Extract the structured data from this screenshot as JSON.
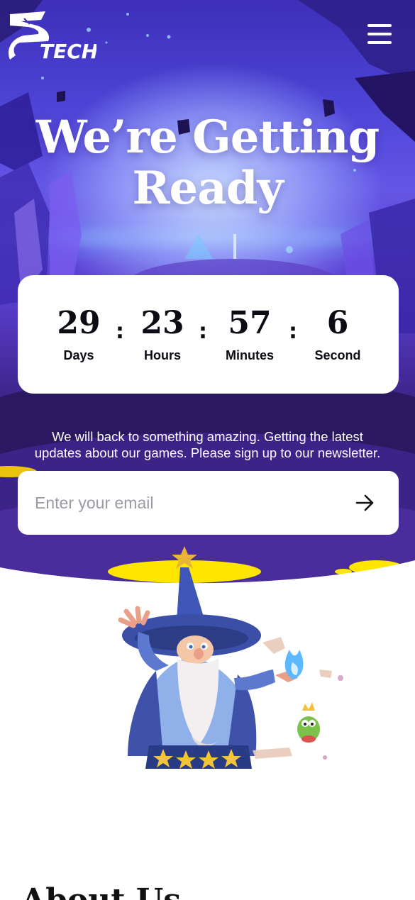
{
  "brand": {
    "logo_text": "TECH",
    "icon": "ztech-logo"
  },
  "nav": {
    "menu_icon": "hamburger-menu-icon"
  },
  "hero": {
    "headline_line1": "We’re Getting",
    "headline_line2": "Ready"
  },
  "countdown": {
    "days": {
      "value": "29",
      "label": "Days"
    },
    "hours": {
      "value": "23",
      "label": "Hours"
    },
    "minutes": {
      "value": "57",
      "label": "Minutes"
    },
    "seconds": {
      "value": "6",
      "label": "Second"
    },
    "separator": ":"
  },
  "newsletter": {
    "message_line1": "We will back to something amazing. Getting the latest",
    "message_line2": "updates about our games. Please sign up to our newsletter.",
    "email_placeholder": "Enter your email",
    "submit_icon": "arrow-right-icon"
  },
  "about": {
    "heading": "About Us"
  },
  "colors": {
    "hero_top": "#3d2fb8",
    "hero_bottom": "#1f1348",
    "card": "#ffffff",
    "text_dark": "#0c0c14",
    "accent_yellow": "#ffe600"
  }
}
